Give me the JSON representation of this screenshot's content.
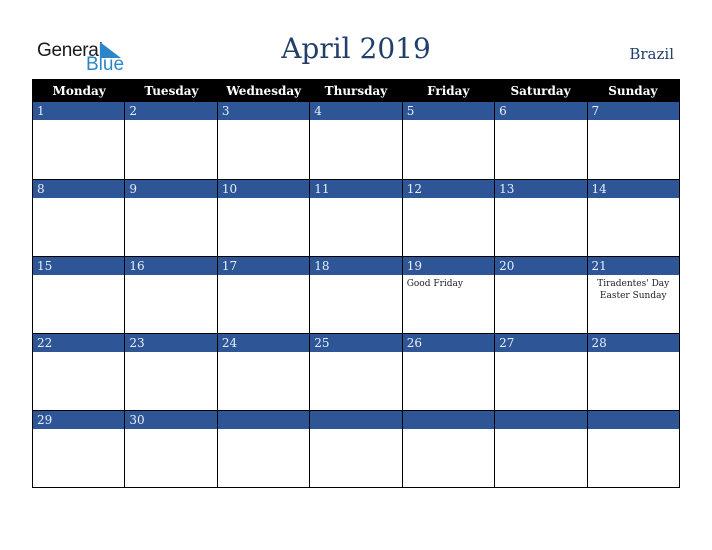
{
  "logo": {
    "general": "General",
    "blue": "Blue"
  },
  "header": {
    "title": "April 2019",
    "country": "Brazil"
  },
  "colors": {
    "band": "#2e5596",
    "title": "#223f6b",
    "logo_blue": "#2a86c8"
  },
  "weekdays": [
    "Monday",
    "Tuesday",
    "Wednesday",
    "Thursday",
    "Friday",
    "Saturday",
    "Sunday"
  ],
  "weeks": [
    {
      "days": [
        {
          "n": "1"
        },
        {
          "n": "2"
        },
        {
          "n": "3"
        },
        {
          "n": "4"
        },
        {
          "n": "5"
        },
        {
          "n": "6"
        },
        {
          "n": "7"
        }
      ]
    },
    {
      "days": [
        {
          "n": "8"
        },
        {
          "n": "9"
        },
        {
          "n": "10"
        },
        {
          "n": "11"
        },
        {
          "n": "12"
        },
        {
          "n": "13"
        },
        {
          "n": "14"
        }
      ]
    },
    {
      "days": [
        {
          "n": "15"
        },
        {
          "n": "16"
        },
        {
          "n": "17"
        },
        {
          "n": "18"
        },
        {
          "n": "19",
          "events": [
            "Good Friday"
          ]
        },
        {
          "n": "20"
        },
        {
          "n": "21",
          "events": [
            "Tiradentes' Day",
            "Easter Sunday"
          ]
        }
      ]
    },
    {
      "days": [
        {
          "n": "22"
        },
        {
          "n": "23"
        },
        {
          "n": "24"
        },
        {
          "n": "25"
        },
        {
          "n": "26"
        },
        {
          "n": "27"
        },
        {
          "n": "28"
        }
      ]
    },
    {
      "days": [
        {
          "n": "29"
        },
        {
          "n": "30"
        },
        {
          "n": ""
        },
        {
          "n": ""
        },
        {
          "n": ""
        },
        {
          "n": ""
        },
        {
          "n": ""
        }
      ]
    }
  ]
}
